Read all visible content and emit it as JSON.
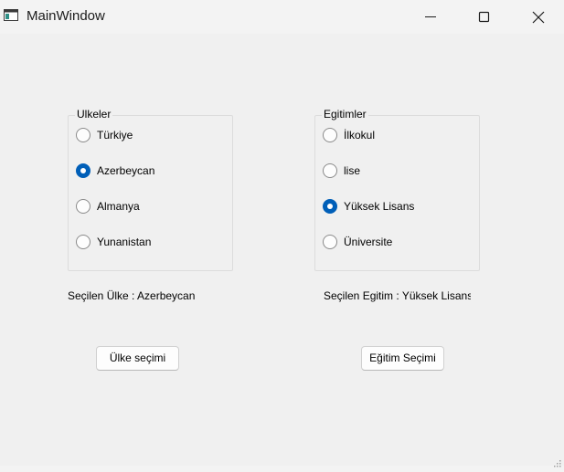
{
  "window": {
    "title": "MainWindow"
  },
  "icons": {
    "app": "app-window-icon",
    "minimize": "minimize-icon",
    "maximize": "maximize-icon",
    "close": "close-icon",
    "size_grip": "size-grip-icon"
  },
  "colors": {
    "accent": "#005fb8",
    "background": "#f0f0f0"
  },
  "countries": {
    "title": "Ulkeler",
    "options": [
      {
        "label": "Türkiye",
        "checked": false
      },
      {
        "label": "Azerbeycan",
        "checked": true
      },
      {
        "label": "Almanya",
        "checked": false
      },
      {
        "label": "Yunanistan",
        "checked": false
      }
    ],
    "result_label": "Seçilen Ülke : Azerbeycan",
    "button_label": "Ülke seçimi"
  },
  "education": {
    "title": "Egitimler",
    "options": [
      {
        "label": "İlkokul",
        "checked": false
      },
      {
        "label": "lise",
        "checked": false
      },
      {
        "label": "Yüksek Lisans",
        "checked": true
      },
      {
        "label": "Üniversite",
        "checked": false
      }
    ],
    "result_label": "Seçilen Egitim : Yüksek Lisans",
    "button_label": "Eğitim Seçimi"
  }
}
